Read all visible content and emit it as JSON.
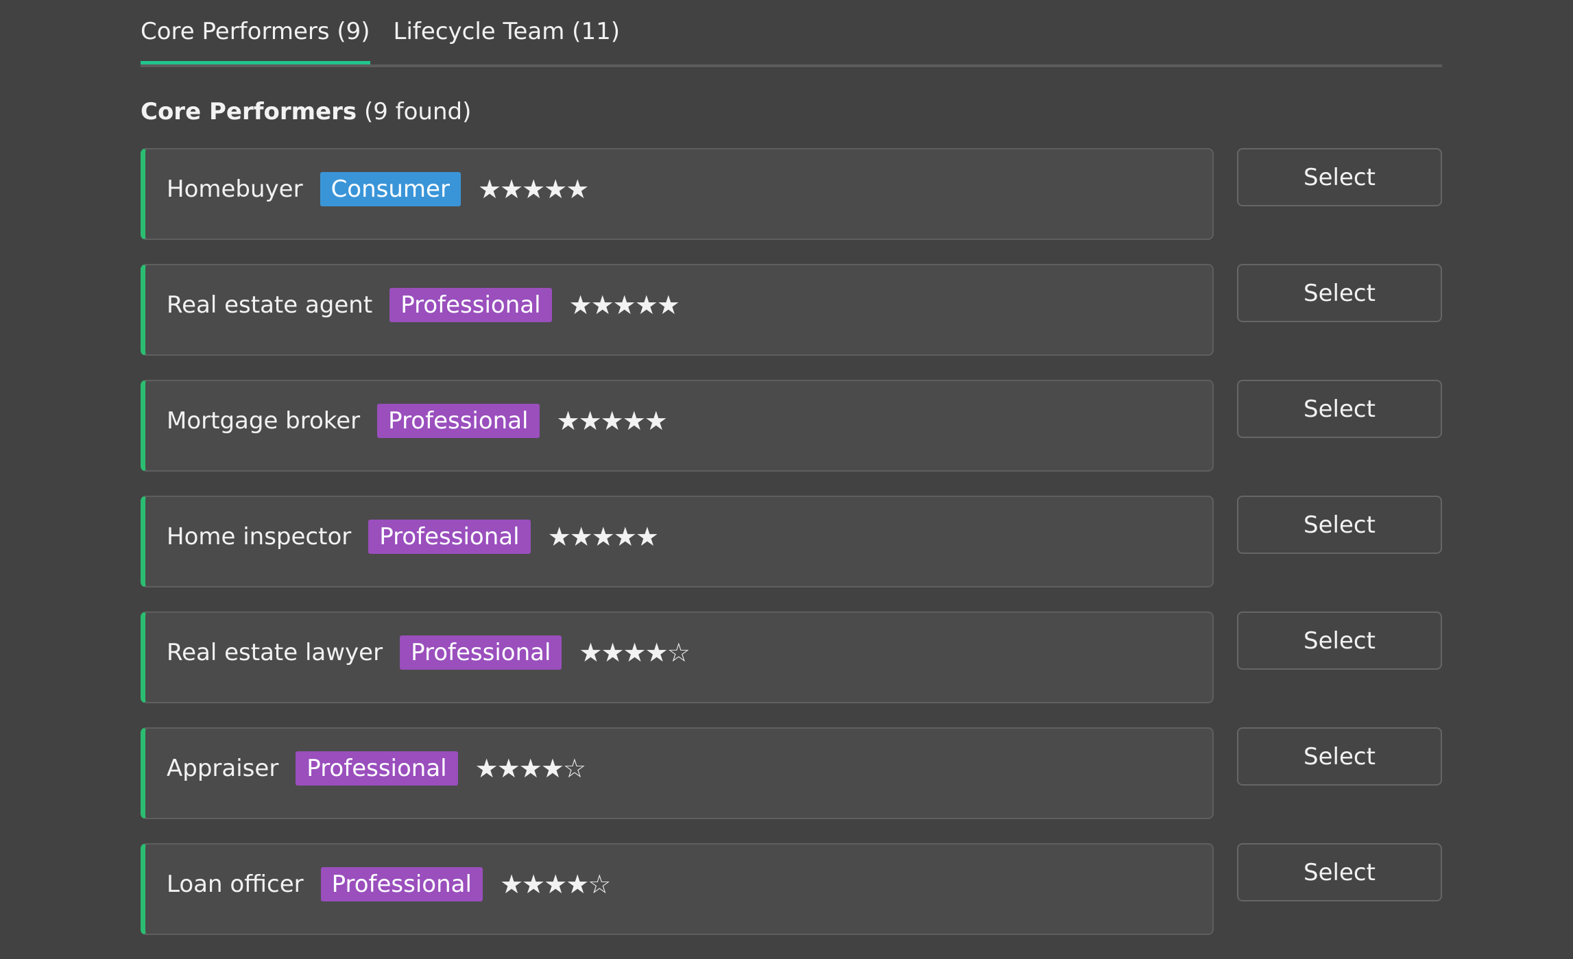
{
  "tabs": [
    {
      "label": "Core Performers (9)",
      "active": true
    },
    {
      "label": "Lifecycle Team (11)",
      "active": false
    }
  ],
  "section": {
    "title_bold": "Core Performers",
    "title_count": "(9 found)"
  },
  "colors": {
    "accent_green": "#21c48e",
    "consumer_badge": "#3a95d8",
    "professional_badge": "#9a4fbd"
  },
  "roles": [
    {
      "name": "Homebuyer",
      "badge": "Consumer",
      "badge_type": "consumer",
      "rating": 5,
      "stars": "★★★★★",
      "button": "Select"
    },
    {
      "name": "Real estate agent",
      "badge": "Professional",
      "badge_type": "professional",
      "rating": 5,
      "stars": "★★★★★",
      "button": "Select"
    },
    {
      "name": "Mortgage broker",
      "badge": "Professional",
      "badge_type": "professional",
      "rating": 5,
      "stars": "★★★★★",
      "button": "Select"
    },
    {
      "name": "Home inspector",
      "badge": "Professional",
      "badge_type": "professional",
      "rating": 5,
      "stars": "★★★★★",
      "button": "Select"
    },
    {
      "name": "Real estate lawyer",
      "badge": "Professional",
      "badge_type": "professional",
      "rating": 4,
      "stars": "★★★★☆",
      "button": "Select"
    },
    {
      "name": "Appraiser",
      "badge": "Professional",
      "badge_type": "professional",
      "rating": 4,
      "stars": "★★★★☆",
      "button": "Select"
    },
    {
      "name": "Loan officer",
      "badge": "Professional",
      "badge_type": "professional",
      "rating": 4,
      "stars": "★★★★☆",
      "button": "Select"
    }
  ]
}
